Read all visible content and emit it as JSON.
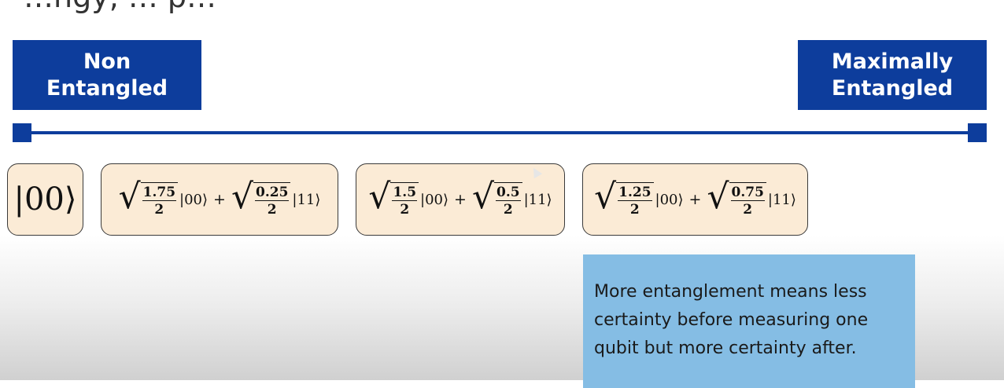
{
  "header": {
    "clipped_text": "…ngy, … p…"
  },
  "scale": {
    "left_label_line1": "Non",
    "left_label_line2": "Entangled",
    "right_label_line1": "Maximally",
    "right_label_line2": "Entangled"
  },
  "states": [
    {
      "ket": "|00⟩"
    },
    {
      "a_num": "1.75",
      "a_den": "2",
      "a_ket": "|00⟩",
      "plus": "+",
      "b_num": "0.25",
      "b_den": "2",
      "b_ket": "|11⟩"
    },
    {
      "a_num": "1.5",
      "a_den": "2",
      "a_ket": "|00⟩",
      "plus": "+",
      "b_num": "0.5",
      "b_den": "2",
      "b_ket": "|11⟩"
    },
    {
      "a_num": "1.25",
      "a_den": "2",
      "a_ket": "|00⟩",
      "plus": "+",
      "b_num": "0.75",
      "b_den": "2",
      "b_ket": "|11⟩"
    }
  ],
  "note": {
    "text": "More entanglement means less certainty before measuring one qubit but more certainty after."
  },
  "colors": {
    "brand_blue": "#0d3d9c",
    "state_fill": "#fbebd6",
    "note_fill": "#85bde4"
  }
}
